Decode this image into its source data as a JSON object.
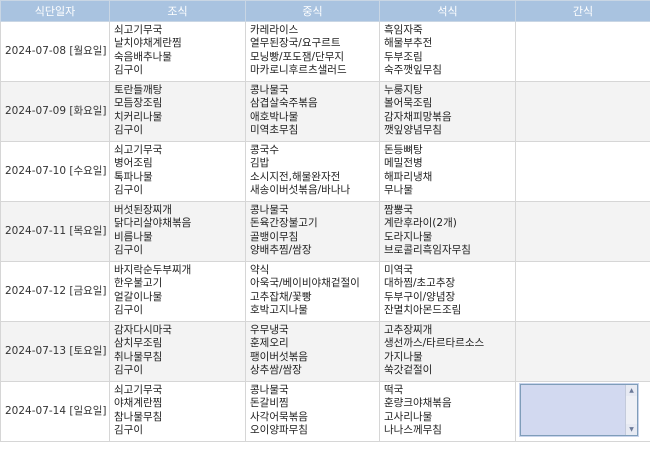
{
  "headers": [
    "식단일자",
    "조식",
    "중식",
    "석식",
    "간식"
  ],
  "rows": [
    {
      "date": "2024-07-08 [월요일]",
      "breakfast": [
        "쇠고기무국",
        "날치야채계란찜",
        "숙음배추나물",
        "김구이"
      ],
      "lunch": [
        "카레라이스",
        "열무된장국/요구르트",
        "모닝빵/포도잼/단무지",
        "마카로니후르츠샐러드"
      ],
      "dinner": [
        "흑임자죽",
        "해물부추전",
        "두부조림",
        "숙주깻잎무침"
      ],
      "snack": []
    },
    {
      "date": "2024-07-09 [화요일]",
      "breakfast": [
        "토란들깨탕",
        "모듬장조림",
        "치커리나물",
        "김구이"
      ],
      "lunch": [
        "콩나물국",
        "삼겹살숙주볶음",
        "애호박나물",
        "미역초무침"
      ],
      "dinner": [
        "누룽지탕",
        "볼어묵조림",
        "감자채피망볶음",
        "깻잎양념무침"
      ],
      "snack": []
    },
    {
      "date": "2024-07-10 [수요일]",
      "breakfast": [
        "쇠고기무국",
        "병어조림",
        "톡파나물",
        "김구이"
      ],
      "lunch": [
        "콩국수",
        "김밥",
        "소시지전,해물완자전",
        "새송이버섯볶음/바나나"
      ],
      "dinner": [
        "돈등뼈탕",
        "메밀전병",
        "해파리냉채",
        "무나물"
      ],
      "snack": []
    },
    {
      "date": "2024-07-11 [목요일]",
      "breakfast": [
        "버섯된장찌개",
        "닭다리살야채볶음",
        "비름나물",
        "김구이"
      ],
      "lunch": [
        "콩나물국",
        "돈육간장불고기",
        "골뱅이무침",
        "양배추찜/쌈장"
      ],
      "dinner": [
        "짬뽕국",
        "계란후라이(2개)",
        "도라지나물",
        "브로콜리흑임자무침"
      ],
      "snack": []
    },
    {
      "date": "2024-07-12 [금요일]",
      "breakfast": [
        "바지락순두부찌개",
        "한우불고기",
        "얼갈이나물",
        "김구이"
      ],
      "lunch": [
        "약식",
        "아욱국/베이비야채겉절이",
        "고추잡채/꽃빵",
        "호박고지나물"
      ],
      "dinner": [
        "미역국",
        "대하찜/초고추장",
        "두부구이/양념장",
        "잔멸치아몬드조림"
      ],
      "snack": []
    },
    {
      "date": "2024-07-13 [토요일]",
      "breakfast": [
        "감자다시마국",
        "삼치무조림",
        "취나물무침",
        "김구이"
      ],
      "lunch": [
        "우무냉국",
        "훈제오리",
        "팽이버섯볶음",
        "상추쌈/쌈장"
      ],
      "dinner": [
        "고추장찌개",
        "생선까스/타르타르소스",
        "가지나물",
        "쑥갓겉절이"
      ],
      "snack": []
    },
    {
      "date": "2024-07-14 [일요일]",
      "breakfast": [
        "쇠고기무국",
        "야채계란찜",
        "참나물무침",
        "김구이"
      ],
      "lunch": [
        "콩나물국",
        "돈갈비찜",
        "사각어묵볶음",
        "오이양파무침"
      ],
      "dinner": [
        "떡국",
        "훈량크야채볶음",
        "고사리나물",
        "나나스께무침"
      ],
      "snack": [],
      "snack_input": true
    }
  ]
}
